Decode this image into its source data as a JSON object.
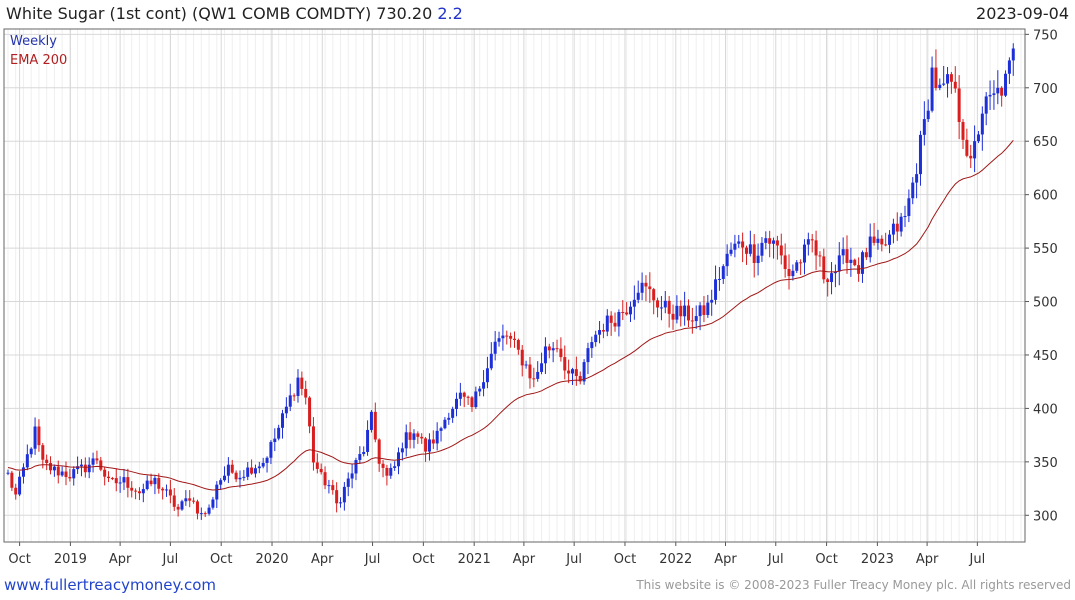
{
  "header": {
    "title": "White Sugar (1st cont) (QW1 COMB COMDTY) 730.20",
    "change": "2.2",
    "date": "2023-09-04"
  },
  "footer": {
    "site_link": "www.fullertreacymoney.com",
    "copyright": "This website is © 2008-2023 Fuller Treacy Money plc. All rights reserved"
  },
  "colors": {
    "up": "#1d2fd6",
    "down": "#d81e1e",
    "ema": "#a01818",
    "grid": "#d8d8d8",
    "legend_weekly": "#2233aa",
    "legend_ema": "#b02020"
  },
  "chart_data": {
    "type": "candlestick",
    "interval": "weekly",
    "legend": [
      {
        "name": "Weekly",
        "position": "top-left"
      },
      {
        "name": "EMA 200",
        "position": "top-left"
      }
    ],
    "ylim": [
      275,
      755
    ],
    "y_ticks": [
      300,
      350,
      400,
      450,
      500,
      550,
      600,
      650,
      700,
      750
    ],
    "x_ticks": [
      {
        "label": "Oct",
        "date": "2018-10-01"
      },
      {
        "label": "2019",
        "date": "2019-01-01"
      },
      {
        "label": "Apr",
        "date": "2019-04-01"
      },
      {
        "label": "Jul",
        "date": "2019-07-01"
      },
      {
        "label": "Oct",
        "date": "2019-10-01"
      },
      {
        "label": "2020",
        "date": "2020-01-01"
      },
      {
        "label": "Apr",
        "date": "2020-04-01"
      },
      {
        "label": "Jul",
        "date": "2020-07-01"
      },
      {
        "label": "Oct",
        "date": "2020-10-01"
      },
      {
        "label": "2021",
        "date": "2021-01-01"
      },
      {
        "label": "Apr",
        "date": "2021-04-01"
      },
      {
        "label": "Jul",
        "date": "2021-07-01"
      },
      {
        "label": "Oct",
        "date": "2021-10-01"
      },
      {
        "label": "2022",
        "date": "2022-01-01"
      },
      {
        "label": "Apr",
        "date": "2022-04-01"
      },
      {
        "label": "Jul",
        "date": "2022-07-01"
      },
      {
        "label": "Oct",
        "date": "2022-10-01"
      },
      {
        "label": "2023",
        "date": "2023-01-01"
      },
      {
        "label": "Apr",
        "date": "2023-04-01"
      },
      {
        "label": "Jul",
        "date": "2023-07-01"
      }
    ],
    "x_range": [
      "2018-09-10",
      "2023-09-18"
    ],
    "grid": true,
    "close_anchors": [
      [
        "2018-09-10",
        338
      ],
      [
        "2018-09-24",
        318
      ],
      [
        "2018-10-15",
        355
      ],
      [
        "2018-10-29",
        378
      ],
      [
        "2018-11-12",
        348
      ],
      [
        "2018-12-03",
        342
      ],
      [
        "2018-12-31",
        338
      ],
      [
        "2019-01-28",
        345
      ],
      [
        "2019-02-18",
        353
      ],
      [
        "2019-03-11",
        330
      ],
      [
        "2019-04-08",
        332
      ],
      [
        "2019-05-06",
        322
      ],
      [
        "2019-06-03",
        332
      ],
      [
        "2019-06-24",
        320
      ],
      [
        "2019-07-15",
        305
      ],
      [
        "2019-08-05",
        318
      ],
      [
        "2019-08-26",
        300
      ],
      [
        "2019-09-09",
        305
      ],
      [
        "2019-09-23",
        330
      ],
      [
        "2019-10-14",
        342
      ],
      [
        "2019-11-04",
        338
      ],
      [
        "2019-11-25",
        345
      ],
      [
        "2019-12-16",
        350
      ],
      [
        "2020-01-06",
        372
      ],
      [
        "2020-01-27",
        400
      ],
      [
        "2020-02-17",
        428
      ],
      [
        "2020-03-02",
        410
      ],
      [
        "2020-03-16",
        352
      ],
      [
        "2020-03-30",
        335
      ],
      [
        "2020-04-13",
        328
      ],
      [
        "2020-04-27",
        310
      ],
      [
        "2020-05-11",
        325
      ],
      [
        "2020-06-01",
        348
      ],
      [
        "2020-06-15",
        362
      ],
      [
        "2020-06-29",
        390
      ],
      [
        "2020-07-13",
        352
      ],
      [
        "2020-07-27",
        335
      ],
      [
        "2020-08-10",
        345
      ],
      [
        "2020-08-24",
        368
      ],
      [
        "2020-09-14",
        380
      ],
      [
        "2020-10-05",
        362
      ],
      [
        "2020-10-26",
        375
      ],
      [
        "2020-11-16",
        398
      ],
      [
        "2020-12-07",
        410
      ],
      [
        "2020-12-28",
        400
      ],
      [
        "2021-01-18",
        432
      ],
      [
        "2021-02-08",
        460
      ],
      [
        "2021-03-01",
        468
      ],
      [
        "2021-03-22",
        452
      ],
      [
        "2021-04-05",
        440
      ],
      [
        "2021-04-19",
        425
      ],
      [
        "2021-05-10",
        455
      ],
      [
        "2021-05-31",
        460
      ],
      [
        "2021-06-21",
        432
      ],
      [
        "2021-07-12",
        425
      ],
      [
        "2021-08-02",
        465
      ],
      [
        "2021-08-23",
        478
      ],
      [
        "2021-09-13",
        485
      ],
      [
        "2021-10-04",
        495
      ],
      [
        "2021-10-25",
        515
      ],
      [
        "2021-11-15",
        508
      ],
      [
        "2021-12-06",
        495
      ],
      [
        "2021-12-27",
        490
      ],
      [
        "2022-01-17",
        488
      ],
      [
        "2022-02-07",
        485
      ],
      [
        "2022-02-28",
        495
      ],
      [
        "2022-03-21",
        525
      ],
      [
        "2022-04-11",
        548
      ],
      [
        "2022-05-02",
        555
      ],
      [
        "2022-05-23",
        545
      ],
      [
        "2022-06-13",
        560
      ],
      [
        "2022-07-04",
        550
      ],
      [
        "2022-07-25",
        525
      ],
      [
        "2022-08-15",
        540
      ],
      [
        "2022-09-05",
        555
      ],
      [
        "2022-09-26",
        525
      ],
      [
        "2022-10-17",
        530
      ],
      [
        "2022-11-07",
        545
      ],
      [
        "2022-11-28",
        532
      ],
      [
        "2022-12-19",
        552
      ],
      [
        "2023-01-09",
        548
      ],
      [
        "2023-01-30",
        565
      ],
      [
        "2023-02-20",
        578
      ],
      [
        "2023-03-06",
        610
      ],
      [
        "2023-03-27",
        665
      ],
      [
        "2023-04-10",
        715
      ],
      [
        "2023-04-24",
        695
      ],
      [
        "2023-05-15",
        705
      ],
      [
        "2023-06-05",
        660
      ],
      [
        "2023-06-19",
        625
      ],
      [
        "2023-07-10",
        680
      ],
      [
        "2023-07-31",
        690
      ],
      [
        "2023-08-21",
        705
      ],
      [
        "2023-09-04",
        730
      ]
    ]
  }
}
